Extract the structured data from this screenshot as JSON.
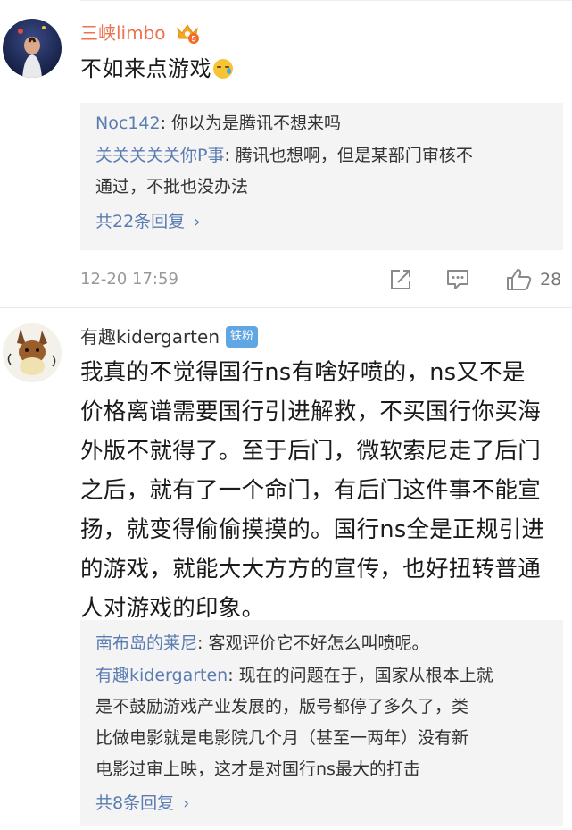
{
  "comments": [
    {
      "username": "三峡limbo",
      "badge_icon": "vip-crown-icon",
      "text_lines": [
        "不如来点游戏"
      ],
      "emoji": "sad-tear-emoji-icon",
      "replies": [
        {
          "who": "Noc142",
          "sep": ": ",
          "lines": [
            "你以为是腾讯不想来吗"
          ]
        },
        {
          "who": "关关关关关你P事",
          "sep": ": ",
          "lines": [
            "腾讯也想啊，但是某部门审核不",
            "通过，不批也没办法"
          ]
        }
      ],
      "more": "共22条回复",
      "more_chevron": "›",
      "time": "12-20 17:59",
      "like_count": "28"
    },
    {
      "username": "有趣kidergarten",
      "badge": "铁粉",
      "text_lines": [
        "我真的不觉得国行ns有啥好喷的，ns又不是",
        "价格离谱需要国行引进解救，不买国行你买海",
        "外版不就得了。至于后门，微软索尼走了后门",
        "之后，就有了一个命门，有后门这件事不能宣",
        "扬，就变得偷偷摸摸的。国行ns全是正规引进",
        "的游戏，就能大大方方的宣传，也好扭转普通",
        "人对游戏的印象。"
      ],
      "replies": [
        {
          "who": "南布岛的莱尼",
          "sep": ": ",
          "lines": [
            "客观评价它不好怎么叫喷呢。"
          ]
        },
        {
          "who": "有趣kidergarten",
          "sep": ": ",
          "lines": [
            "现在的问题在于，国家从根本上就",
            "是不鼓励游戏产业发展的，版号都停了多久了，类",
            "比做电影就是电影院几个月（甚至一两年）没有新",
            "电影过审上映，这才是对国行ns最大的打击"
          ]
        }
      ],
      "more": "共8条回复",
      "more_chevron": "›"
    }
  ],
  "colors": {
    "username_highlight": "#eb7350",
    "link": "#5a7cb0",
    "reply_bg": "#f4f4f4",
    "fan_badge": "#5fa6e3"
  }
}
